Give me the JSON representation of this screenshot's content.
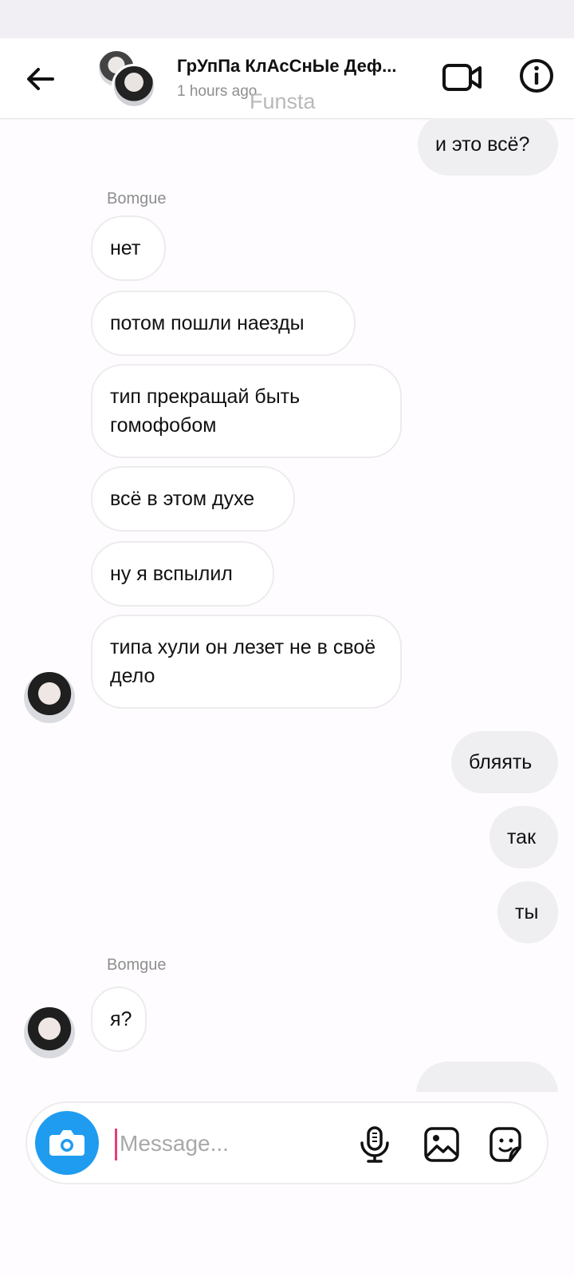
{
  "header": {
    "title": "ГрУпПа КлАсСнЫе Деф...",
    "subtitle": "1 hours ago",
    "watermark": "Funsta"
  },
  "messages": [
    {
      "side": "out",
      "text": "и это всё?"
    },
    {
      "side": "label",
      "text": "Bomgue"
    },
    {
      "side": "in",
      "text": "нет"
    },
    {
      "side": "in",
      "text": "потом пошли наезды"
    },
    {
      "side": "in",
      "text": "тип прекращай быть гомофобом"
    },
    {
      "side": "in",
      "text": "всё в этом духе"
    },
    {
      "side": "in",
      "text": "ну я вспылил"
    },
    {
      "side": "in",
      "text": "типа хули он лезет не в своё дело"
    },
    {
      "side": "out",
      "text": "бляять"
    },
    {
      "side": "out",
      "text": "так"
    },
    {
      "side": "out",
      "text": "ты"
    },
    {
      "side": "label",
      "text": "Bomgue"
    },
    {
      "side": "in",
      "text": "я?"
    }
  ],
  "composer": {
    "placeholder": "Message..."
  },
  "colors": {
    "accent": "#1f9cf0",
    "cursor": "#e4407b",
    "outgoing_bubble": "#efeef1",
    "incoming_border": "#ececec"
  }
}
